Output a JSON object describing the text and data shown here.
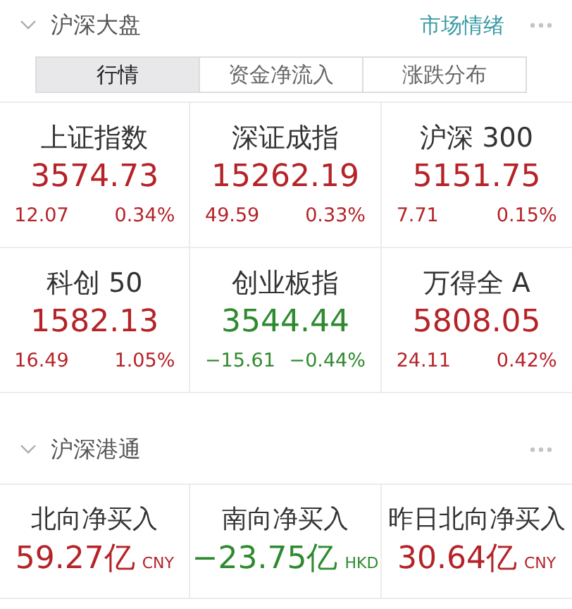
{
  "market": {
    "title": "沪深大盘",
    "link": "市场情绪",
    "expanded": true,
    "tabs": [
      {
        "label": "行情",
        "selected": true
      },
      {
        "label": "资金净流入",
        "selected": false
      },
      {
        "label": "涨跌分布",
        "selected": false
      }
    ],
    "indices": [
      {
        "name": "上证指数",
        "value": "3574.73",
        "change": "12.07",
        "percent": "0.34%",
        "color": "#b52328"
      },
      {
        "name": "深证成指",
        "value": "15262.19",
        "change": "49.59",
        "percent": "0.33%",
        "color": "#b52328"
      },
      {
        "name": "沪深 300",
        "value": "5151.75",
        "change": "7.71",
        "percent": "0.15%",
        "color": "#b52328"
      },
      {
        "name": "科创 50",
        "value": "1582.13",
        "change": "16.49",
        "percent": "1.05%",
        "color": "#b52328"
      },
      {
        "name": "创业板指",
        "value": "3544.44",
        "change": "−15.61",
        "percent": "−0.44%",
        "color": "#2f8a2f"
      },
      {
        "name": "万得全 A",
        "value": "5808.05",
        "change": "24.11",
        "percent": "0.42%",
        "color": "#b52328"
      }
    ]
  },
  "connect": {
    "title": "沪深港通",
    "expanded": true,
    "flows": [
      {
        "name": "北向净买入",
        "value": "59.27亿",
        "currency": "CNY",
        "color": "#b52328"
      },
      {
        "name": "南向净买入",
        "value": "−23.75亿",
        "currency": "HKD",
        "color": "#2f8a2f"
      },
      {
        "name": "昨日北向净买入",
        "value": "30.64亿",
        "currency": "CNY",
        "color": "#b52328"
      }
    ]
  }
}
